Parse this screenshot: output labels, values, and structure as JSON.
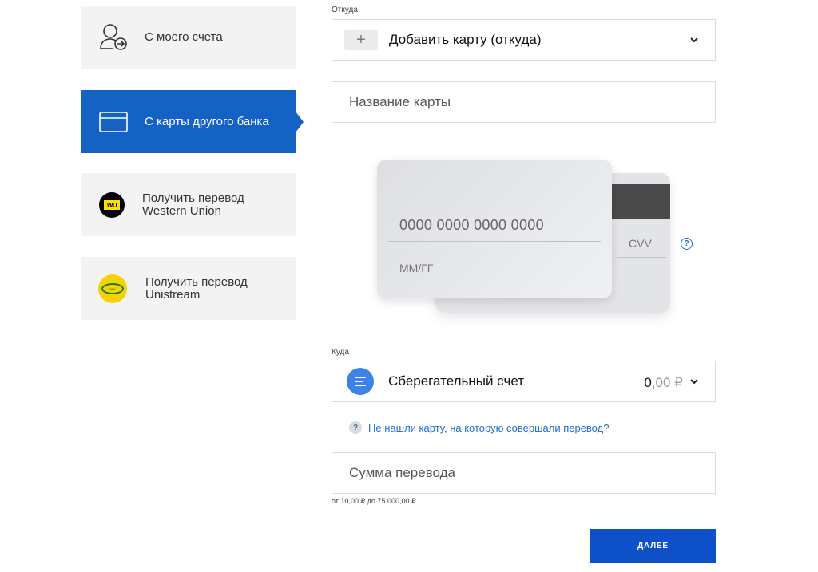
{
  "nav": {
    "items": [
      {
        "label": "С моего счета",
        "icon": "user-transfer-icon"
      },
      {
        "label": "С карты другого банка",
        "icon": "credit-card-icon"
      },
      {
        "label_line1": "Получить перевод",
        "label_line2": "Western Union",
        "icon": "western-union-logo"
      },
      {
        "label_line1": "Получить перевод",
        "label_line2": "Unistream",
        "icon": "unistream-logo"
      }
    ]
  },
  "from": {
    "label": "Откуда",
    "add_card": "Добавить карту (откуда)",
    "plus": "+"
  },
  "card_name": {
    "placeholder": "Название карты"
  },
  "card": {
    "number": "0000 0000 0000 0000",
    "expiry": "ММ/ГГ",
    "cvv": "CVV",
    "help": "?"
  },
  "to": {
    "label": "Куда",
    "account": "Сберегательный счет",
    "balance_int": "0",
    "balance_frac": ",00 ₽"
  },
  "hint": {
    "badge": "?",
    "text": "Не нашли карту, на которую совершали перевод?"
  },
  "amount": {
    "placeholder": "Сумма перевода",
    "limits": "от 10,00 ₽ до 75 000,00 ₽"
  },
  "submit_label": "ДАЛЕЕ",
  "colors": {
    "accent": "#1462c4",
    "button": "#0e50c8",
    "link": "#1e6fd6",
    "western_union": "#ffdd00",
    "unistream": "#f5d300"
  }
}
